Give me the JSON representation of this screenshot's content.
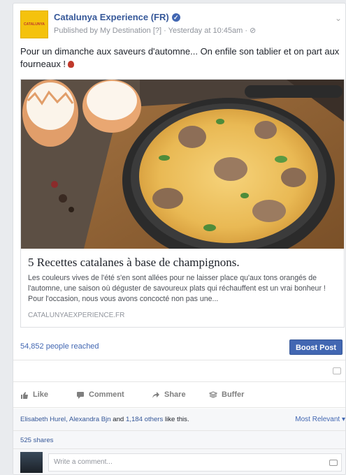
{
  "post": {
    "page_name": "Catalunya Experience (FR)",
    "logo_text": "CATALUNYA",
    "published_by": "Published by My Destination",
    "meta_suffix": "[?] · Yesterday at 10:45am · ⊘",
    "text": "Pour un dimanche aux saveurs d'automne... On enfile son tablier et on part aux fourneaux !"
  },
  "link": {
    "title": "5 Recettes catalanes à base de champignons.",
    "description": "Les couleurs vives de l'été s'en sont allées pour ne laisser place qu'aux tons orangés de l'automne, une saison où déguster de savoureux plats qui réchauffent est un vrai bonheur ! Pour l'occasion, nous vous avons concocté non pas une...",
    "domain": "CATALUNYAEXPERIENCE.FR"
  },
  "reach": {
    "text": "54,852 people reached",
    "boost_label": "Boost Post"
  },
  "actions": {
    "like": "Like",
    "comment": "Comment",
    "share": "Share",
    "buffer": "Buffer"
  },
  "engagement": {
    "likers_names": "Elisabeth Hurel, Alexandra Bjn",
    "and_text": "and",
    "others": "1,184 others",
    "like_suffix": "like this.",
    "sort": "Most Relevant ▾",
    "shares": "525 shares"
  },
  "comment": {
    "placeholder": "Write a comment..."
  },
  "colors": {
    "brand_blue": "#4267b2",
    "link_blue": "#365899",
    "logo_yellow": "#f4c20d"
  }
}
